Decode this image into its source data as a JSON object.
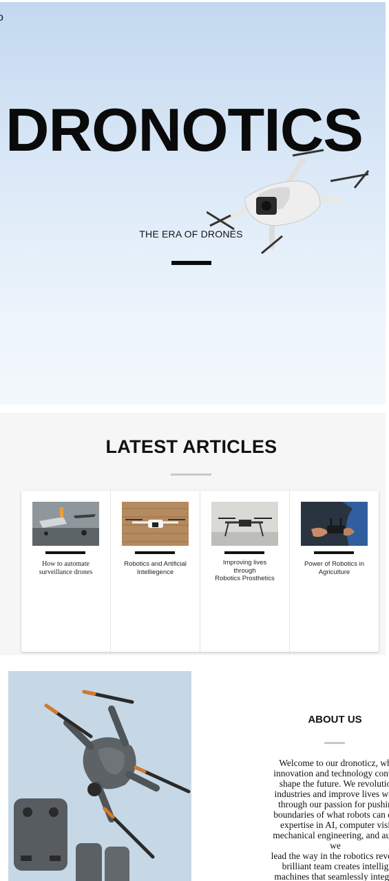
{
  "hero": {
    "corner_logo": "o",
    "title": "DRONOTICS",
    "subtitle": "THE ERA OF DRONES"
  },
  "articles": {
    "heading": "LATEST ARTICLES",
    "items": [
      {
        "title": "How to automate\nsurveillance drones",
        "image": "drone-workshop-photo"
      },
      {
        "title": "Robotics and Artificial\nIntelliegence",
        "image": "drone-brick-wall-photo"
      },
      {
        "title": "Improving lives\nthrough\nRobotics Prosthetics",
        "image": "drone-concrete-wall-photo"
      },
      {
        "title": "Power of Robotics in\nAgriculture",
        "image": "drone-controller-hands-photo"
      }
    ]
  },
  "about": {
    "heading": "ABOUT US",
    "body": "Welcome to our dronoticz, wh\ninnovation and technology conve\nshape the future. We revolutio\nindustries and improve lives wor\nthrough our passion for pushin\nboundaries of what robots can do\nexpertise in AI, computer visi\nmechanical engineering, and auto\nwe\nlead the way in the robotics revolu\nbrilliant team creates intellig\nmachines that seamlessly integra",
    "image": "drone-and-controller-photo"
  },
  "colors": {
    "hero_sky": "#d7e6f6",
    "section_bg": "#f6f6f6",
    "text": "#111111",
    "accent_bar": "#0a0a0a",
    "muted_bar": "#c8c8c8"
  }
}
